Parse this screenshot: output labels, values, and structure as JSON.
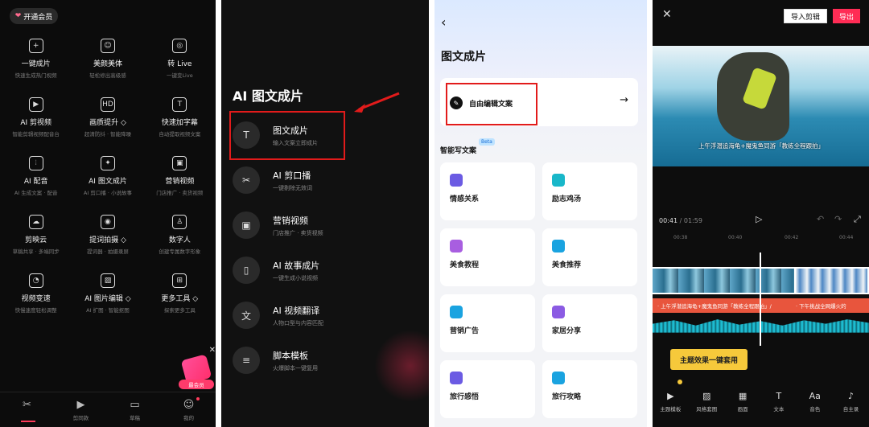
{
  "panel1": {
    "vip_label": "开通会员",
    "tools": [
      {
        "title": "一键成片",
        "sub": "快速生成热门视频",
        "icon": "plus-square-icon",
        "glyph": "+"
      },
      {
        "title": "美颜美体",
        "sub": "轻松修出高级感",
        "icon": "face-icon",
        "glyph": "☺"
      },
      {
        "title": "转 Live",
        "sub": "一键变Live",
        "icon": "live-icon",
        "glyph": "◎"
      },
      {
        "title": "AI 剪视频",
        "sub": "智能剪辑视频配音台",
        "icon": "play-square-icon",
        "glyph": "▶"
      },
      {
        "title": "画质提升 ◇",
        "sub": "超清防抖 · 智能降噪",
        "icon": "hd-icon",
        "glyph": "HD"
      },
      {
        "title": "快速加字幕",
        "sub": "自动提取视频文案",
        "icon": "text-frame-icon",
        "glyph": "T"
      },
      {
        "title": "AI 配音",
        "sub": "AI 生成文案 · 配音",
        "icon": "waveform-icon",
        "glyph": "⦙"
      },
      {
        "title": "AI 图文成片",
        "sub": "AI 剪口播 · 小说故事",
        "icon": "image-plus-icon",
        "glyph": "✦"
      },
      {
        "title": "营销视频",
        "sub": "门店推广 · 卖货视频",
        "icon": "bag-icon",
        "glyph": "▣"
      },
      {
        "title": "剪映云",
        "sub": "草稿共享 · 多端同步",
        "icon": "cloud-icon",
        "glyph": "☁"
      },
      {
        "title": "提词拍摄 ◇",
        "sub": "提词器 · 拍摄录屏",
        "icon": "camera-icon",
        "glyph": "◉"
      },
      {
        "title": "数字人",
        "sub": "创建专属数字形象",
        "icon": "avatar-icon",
        "glyph": "♙"
      },
      {
        "title": "视频变速",
        "sub": "快慢速度轻松调整",
        "icon": "speed-icon",
        "glyph": "◔"
      },
      {
        "title": "AI 图片编辑 ◇",
        "sub": "AI 扩图 · 智能抠图",
        "icon": "image-edit-icon",
        "glyph": "▨"
      },
      {
        "title": "更多工具 ◇",
        "sub": "探索更多工具",
        "icon": "more-tools-icon",
        "glyph": "⊞"
      }
    ],
    "promo_label": "最会员",
    "nav": [
      {
        "label": "",
        "icon": "scissors-icon",
        "glyph": "✂"
      },
      {
        "label": "剪同款",
        "icon": "template-icon",
        "glyph": "▶"
      },
      {
        "label": "草稿",
        "icon": "folder-icon",
        "glyph": "▭"
      },
      {
        "label": "我的",
        "icon": "profile-icon",
        "glyph": "☺"
      }
    ]
  },
  "panel2": {
    "heading": "AI 图文成片",
    "items": [
      {
        "title": "图文成片",
        "sub": "输入文案立即成片",
        "icon": "text-to-video-icon",
        "glyph": "T"
      },
      {
        "title": "AI 剪口播",
        "sub": "一键剔除无效词",
        "icon": "cut-speech-icon",
        "glyph": "✂"
      },
      {
        "title": "营销视频",
        "sub": "门店推广 · 卖货视频",
        "icon": "bag-icon",
        "glyph": "▣"
      },
      {
        "title": "AI 故事成片",
        "sub": "一键生成小说视频",
        "icon": "book-icon",
        "glyph": "▯"
      },
      {
        "title": "AI 视频翻译",
        "sub": "人物口型与内容匹配",
        "icon": "translate-icon",
        "glyph": "文"
      },
      {
        "title": "脚本模板",
        "sub": "火爆脚本一键复用",
        "icon": "document-icon",
        "glyph": "≡"
      }
    ]
  },
  "panel3": {
    "title": "图文成片",
    "card_label": "自由编辑文案",
    "section": "智能写文案",
    "beta": "Beta",
    "categories": [
      {
        "label": "情感关系",
        "color": "#6b5be3"
      },
      {
        "label": "励志鸡汤",
        "color": "#19b7c9"
      },
      {
        "label": "美食教程",
        "color": "#a85ee0"
      },
      {
        "label": "美食推荐",
        "color": "#1aa3e0"
      },
      {
        "label": "营销广告",
        "color": "#1aa3e0"
      },
      {
        "label": "家居分享",
        "color": "#8b5be3"
      },
      {
        "label": "旅行感悟",
        "color": "#6b5be3"
      },
      {
        "label": "旅行攻略",
        "color": "#1aa3e0"
      }
    ]
  },
  "panel4": {
    "import_label": "导入剪辑",
    "export_label": "导出",
    "subtitle": "上午浮潜追海龟+魔鬼鱼同游「教练全程跟拍」",
    "time_current": "00:41",
    "time_total": "/ 01:59",
    "ruler": [
      "00:38",
      "00:40",
      "00:42",
      "00:44"
    ],
    "text_track_a": "· 上午浮潜追海龟+魔鬼鱼同游「教练全程跟拍」/",
    "text_track_b": "· 下午挑战全网爆火的",
    "tooltip": "主题效果一键套用",
    "tools": [
      {
        "label": "主题模板",
        "icon": "theme-template-icon",
        "glyph": "▶"
      },
      {
        "label": "风格套图",
        "icon": "style-image-icon",
        "glyph": "▨"
      },
      {
        "label": "画面",
        "icon": "picture-icon",
        "glyph": "▦"
      },
      {
        "label": "文本",
        "icon": "text-icon",
        "glyph": "T"
      },
      {
        "label": "音色",
        "icon": "voice-icon",
        "glyph": "Aa"
      },
      {
        "label": "自主录",
        "icon": "microphone-icon",
        "glyph": "♪"
      }
    ]
  },
  "colors": {
    "highlight": "#e21b1b",
    "accent": "#ff2c55",
    "tooltip": "#f6c93b"
  }
}
